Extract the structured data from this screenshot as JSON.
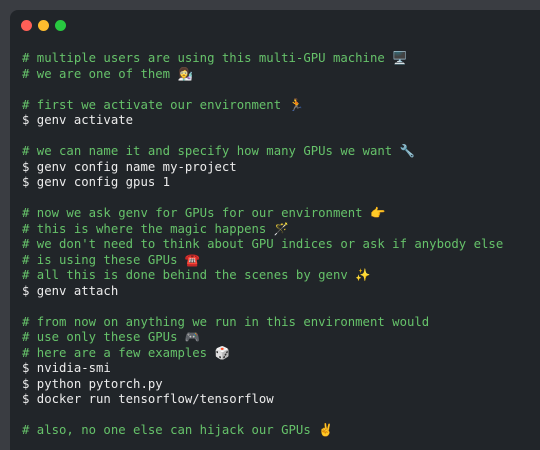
{
  "window": {
    "controls": [
      "close-icon",
      "minimize-icon",
      "zoom-icon"
    ],
    "colors": {
      "background": "#212529",
      "comment": "#66c26a",
      "command": "#ececec",
      "close": "#ff5f57",
      "minimize": "#febc2e",
      "zoom": "#28c840"
    }
  },
  "lines": [
    {
      "type": "comment",
      "text": "# multiple users are using this multi-GPU machine",
      "emoji": "🖥️"
    },
    {
      "type": "comment",
      "text": "# we are one of them",
      "emoji": "👩‍🔬"
    },
    {
      "type": "blank",
      "text": ""
    },
    {
      "type": "comment",
      "text": "# first we activate our environment",
      "emoji": "🏃"
    },
    {
      "type": "command",
      "text": "$ genv activate",
      "emoji": ""
    },
    {
      "type": "blank",
      "text": ""
    },
    {
      "type": "comment",
      "text": "# we can name it and specify how many GPUs we want",
      "emoji": "🔧"
    },
    {
      "type": "command",
      "text": "$ genv config name my-project",
      "emoji": ""
    },
    {
      "type": "command",
      "text": "$ genv config gpus 1",
      "emoji": ""
    },
    {
      "type": "blank",
      "text": ""
    },
    {
      "type": "comment",
      "text": "# now we ask genv for GPUs for our environment",
      "emoji": "👉"
    },
    {
      "type": "comment",
      "text": "# this is where the magic happens",
      "emoji": "🪄"
    },
    {
      "type": "comment",
      "text": "# we don't need to think about GPU indices or ask if anybody else",
      "emoji": ""
    },
    {
      "type": "comment",
      "text": "# is using these GPUs",
      "emoji": "☎️"
    },
    {
      "type": "comment",
      "text": "# all this is done behind the scenes by genv",
      "emoji": "✨"
    },
    {
      "type": "command",
      "text": "$ genv attach",
      "emoji": ""
    },
    {
      "type": "blank",
      "text": ""
    },
    {
      "type": "comment",
      "text": "# from now on anything we run in this environment would",
      "emoji": ""
    },
    {
      "type": "comment",
      "text": "# use only these GPUs",
      "emoji": "🎮"
    },
    {
      "type": "comment",
      "text": "# here are a few examples",
      "emoji": "🎲"
    },
    {
      "type": "command",
      "text": "$ nvidia-smi",
      "emoji": ""
    },
    {
      "type": "command",
      "text": "$ python pytorch.py",
      "emoji": ""
    },
    {
      "type": "command",
      "text": "$ docker run tensorflow/tensorflow",
      "emoji": ""
    },
    {
      "type": "blank",
      "text": ""
    },
    {
      "type": "comment",
      "text": "# also, no one else can hijack our GPUs",
      "emoji": "✌️"
    }
  ]
}
